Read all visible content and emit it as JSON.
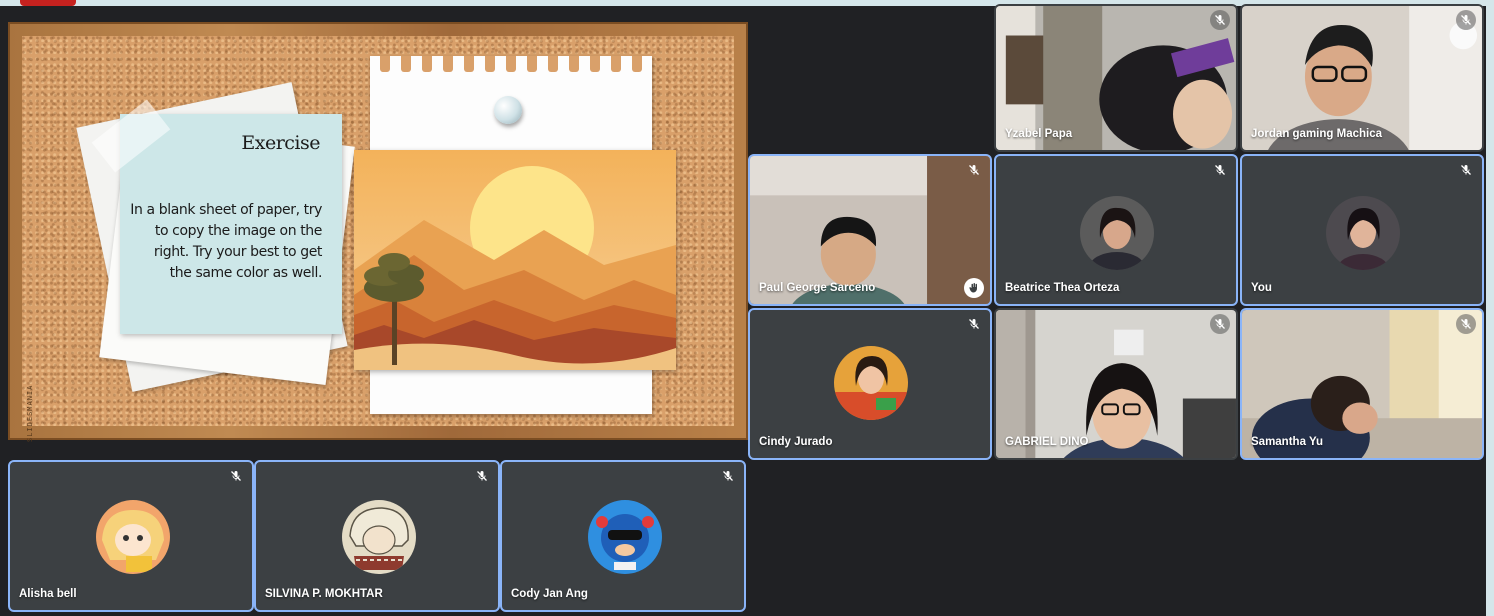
{
  "slide": {
    "credit": "SLIDESMANIA",
    "note_title": "Exercise",
    "note_text": "In a blank sheet of paper, try to copy the image on the right. Try your best to get the same color as well."
  },
  "participants": {
    "p1": {
      "name": "Yzabel Papa",
      "muted": true
    },
    "p2": {
      "name": "Jordan gaming Machica",
      "muted": true
    },
    "p3": {
      "name": "Paul George Sarceno",
      "muted": true,
      "hand_raised": true
    },
    "p4": {
      "name": "Beatrice Thea Orteza",
      "muted": true
    },
    "p5": {
      "name": "You",
      "muted": true
    },
    "p6": {
      "name": "Cindy Jurado",
      "muted": true
    },
    "p7": {
      "name": "GABRIEL DINO",
      "muted": true
    },
    "p8": {
      "name": "Samantha Yu",
      "muted": true
    },
    "p9": {
      "name": "Alisha bell",
      "muted": true
    },
    "p10": {
      "name": "SILVINA P. MOKHTAR",
      "muted": true
    },
    "p11": {
      "name": "Cody Jan Ang",
      "muted": true
    }
  },
  "colors": {
    "background": "#202124",
    "tile_border": "#8ab4f8",
    "tile_background": "#3c4043",
    "note": "#cde7e8"
  },
  "icons": [
    "mic-off-icon",
    "raised-hand-icon",
    "pushpin-icon"
  ]
}
